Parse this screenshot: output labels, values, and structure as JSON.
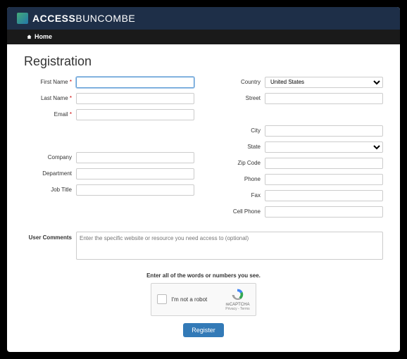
{
  "brand": {
    "bold": "ACCESS",
    "light": "BUNCOMBE"
  },
  "nav": {
    "home": "Home"
  },
  "page": {
    "title": "Registration"
  },
  "form": {
    "first_name": {
      "label": "First Name",
      "req": "*",
      "value": ""
    },
    "last_name": {
      "label": "Last Name",
      "req": "*",
      "value": ""
    },
    "email": {
      "label": "Email",
      "req": "*",
      "value": ""
    },
    "company": {
      "label": "Company",
      "value": ""
    },
    "department": {
      "label": "Department",
      "value": ""
    },
    "job_title": {
      "label": "Job Title",
      "value": ""
    },
    "country": {
      "label": "Country",
      "selected": "United States"
    },
    "street": {
      "label": "Street",
      "value": ""
    },
    "city": {
      "label": "City",
      "value": ""
    },
    "state": {
      "label": "State",
      "selected": ""
    },
    "zip": {
      "label": "Zip Code",
      "value": ""
    },
    "phone": {
      "label": "Phone",
      "value": ""
    },
    "fax": {
      "label": "Fax",
      "value": ""
    },
    "cell": {
      "label": "Cell Phone",
      "value": ""
    },
    "comments": {
      "label": "User Comments",
      "placeholder": "Enter the specific website or resource you need access to (optional)",
      "value": ""
    }
  },
  "captcha": {
    "title": "Enter all of the words or numbers you see.",
    "checkbox_label": "I'm not a robot",
    "brand": "reCAPTCHA",
    "terms": "Privacy - Terms"
  },
  "buttons": {
    "register": "Register"
  }
}
